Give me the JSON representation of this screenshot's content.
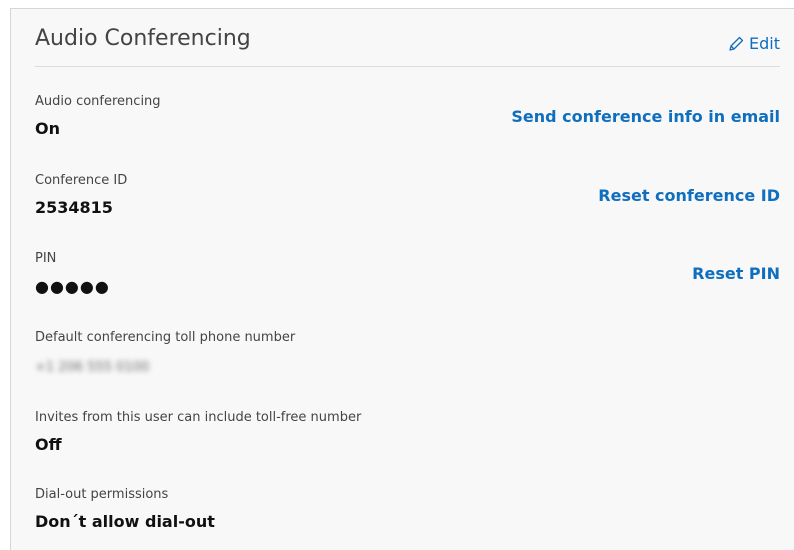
{
  "header": {
    "title": "Audio Conferencing",
    "edit_label": "Edit",
    "edit_icon": "pencil-icon"
  },
  "fields": [
    {
      "label": "Audio conferencing",
      "value": "On"
    },
    {
      "label": "Conference ID",
      "value": "2534815"
    },
    {
      "label": "PIN",
      "value": "●●●●●"
    },
    {
      "label": "Default conferencing toll phone number",
      "value": "+1 206 555 0100"
    },
    {
      "label": "Invites from this user can include toll-free number",
      "value": "Off"
    },
    {
      "label": "Dial-out permissions",
      "value": "Don´t allow dial-out"
    }
  ],
  "actions": {
    "send_info": "Send conference info in email",
    "reset_id": "Reset conference ID",
    "reset_pin": "Reset PIN"
  },
  "colors": {
    "accent": "#106ebe",
    "card_background": "#f8f8f8",
    "value_text": "#111111",
    "label_text": "#444444"
  }
}
